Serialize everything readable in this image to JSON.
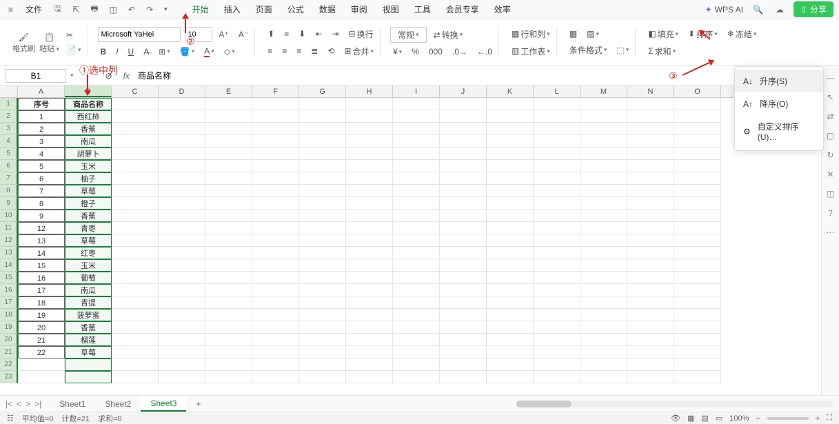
{
  "menubar": {
    "file": "文件",
    "tabs": [
      "开始",
      "插入",
      "页面",
      "公式",
      "数据",
      "审阅",
      "视图",
      "工具",
      "会员专享",
      "效率"
    ],
    "active_tab": 0,
    "wps_ai": "WPS AI",
    "share": "分享"
  },
  "ribbon": {
    "format_painter": "格式刷",
    "paste": "粘贴",
    "font_name": "Microsoft YaHei",
    "font_size": "10",
    "wrap": "换行",
    "merge": "合并",
    "number_format": "常规",
    "transpose": "转换",
    "rowcol": "行和列",
    "worksheet": "工作表",
    "cond_fmt": "条件格式",
    "fill": "填充",
    "sort": "排序",
    "sum": "求和",
    "freeze": "冻结"
  },
  "dropdown": {
    "asc": "升序(S)",
    "desc": "降序(O)",
    "custom": "自定义排序(U)…"
  },
  "namebox": "B1",
  "formula_value": "商品名称",
  "columns": [
    "A",
    "B",
    "C",
    "D",
    "E",
    "F",
    "G",
    "H",
    "I",
    "J",
    "K",
    "L",
    "M",
    "N",
    "O"
  ],
  "data": {
    "header": [
      "序号",
      "商品名称"
    ],
    "rows": [
      [
        "1",
        "西红柿"
      ],
      [
        "2",
        "香蕉"
      ],
      [
        "3",
        "南瓜"
      ],
      [
        "4",
        "胡萝卜"
      ],
      [
        "5",
        "玉米"
      ],
      [
        "6",
        "柚子"
      ],
      [
        "7",
        "草莓"
      ],
      [
        "8",
        "橙子"
      ],
      [
        "9",
        "香蕉"
      ],
      [
        "12",
        "青枣"
      ],
      [
        "13",
        "草莓"
      ],
      [
        "14",
        "红枣"
      ],
      [
        "15",
        "玉米"
      ],
      [
        "16",
        "葡萄"
      ],
      [
        "17",
        "南瓜"
      ],
      [
        "18",
        "青提"
      ],
      [
        "19",
        "菠萝蜜"
      ],
      [
        "20",
        "香蕉"
      ],
      [
        "21",
        "榴莲"
      ],
      [
        "22",
        "草莓"
      ]
    ]
  },
  "sheets": {
    "items": [
      "Sheet1",
      "Sheet2",
      "Sheet3"
    ],
    "active": 2
  },
  "status": {
    "avg": "平均值=0",
    "count": "计数=21",
    "sum": "求和=0",
    "zoom": "100%"
  },
  "annotations": {
    "a1": "①选中列",
    "a2": "②",
    "a3": "③"
  }
}
